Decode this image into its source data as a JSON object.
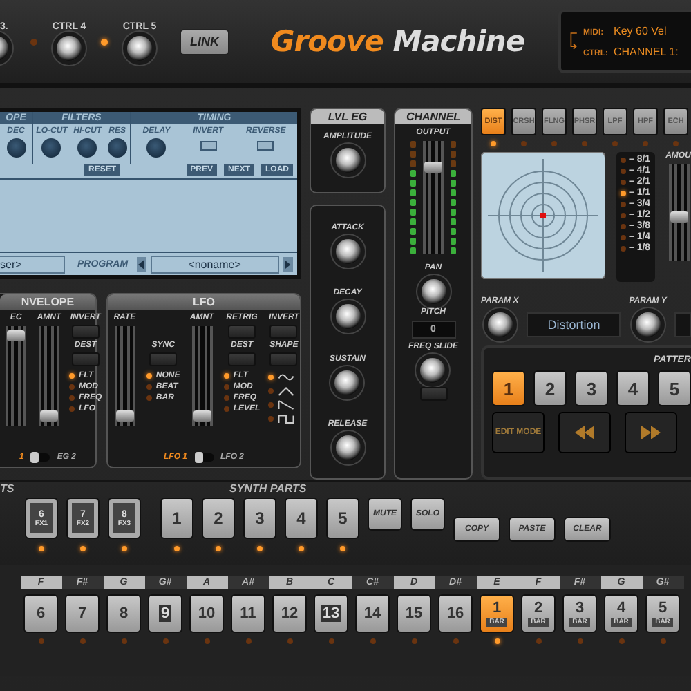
{
  "top": {
    "knobs": [
      {
        "label": "3."
      },
      {
        "label": "CTRL 4"
      },
      {
        "label": "CTRL 5"
      }
    ],
    "leds": [
      {
        "on": false
      },
      {
        "on": true
      }
    ],
    "link": "LINK",
    "logo": [
      "Groove",
      "Machine"
    ],
    "display": [
      {
        "label": "MIDI:",
        "value": "Key 60 Vel"
      },
      {
        "label": "CTRL:",
        "value": "CHANNEL 1:"
      }
    ]
  },
  "sample": {
    "sections": [
      {
        "title": "OPE",
        "knobs": [
          "DEC"
        ]
      },
      {
        "title": "FILTERS",
        "knobs": [
          "LO-CUT",
          "HI-CUT",
          "RES"
        ]
      },
      {
        "title": "TIMING",
        "knobs": [
          "DELAY"
        ],
        "toggles": [
          {
            "label": "INVERT",
            "on": false
          },
          {
            "label": "REVERSE",
            "on": false
          }
        ]
      }
    ],
    "buttons_left": [
      "RESET"
    ],
    "buttons_right": [
      "PREV",
      "NEXT",
      "LOAD"
    ],
    "sample_field": "ser>",
    "program_label": "PROGRAM",
    "program_value": "<noname>"
  },
  "lvl_eg": {
    "title": "LVL EG",
    "knob": "AMPLITUDE"
  },
  "amp_env": {
    "knobs": [
      "ATTACK",
      "DECAY",
      "SUSTAIN",
      "RELEASE"
    ]
  },
  "channel": {
    "title": "CHANNEL",
    "output_label": "OUTPUT",
    "level": 0.8,
    "pan": "PAN",
    "pitch_label": "PITCH",
    "pitch_value": "0",
    "freq_slide": "FREQ SLIDE"
  },
  "fx": {
    "tabs": [
      {
        "label": "DIST",
        "selected": true
      },
      {
        "label": "CRSH",
        "selected": false
      },
      {
        "label": "FLNG",
        "selected": false
      },
      {
        "label": "PHSR",
        "selected": false
      },
      {
        "label": "LPF",
        "selected": false
      },
      {
        "label": "HPF",
        "selected": false
      },
      {
        "label": "ECH",
        "selected": false
      }
    ],
    "rates": [
      {
        "label": "– 8/1",
        "selected": false
      },
      {
        "label": "– 4/1",
        "selected": false
      },
      {
        "label": "– 2/1",
        "selected": false
      },
      {
        "label": "– 1/1",
        "selected": true
      },
      {
        "label": "– 3/4",
        "selected": false
      },
      {
        "label": "– 1/2",
        "selected": false
      },
      {
        "label": "– 3/8",
        "selected": false
      },
      {
        "label": "– 1/4",
        "selected": false
      },
      {
        "label": "– 1/8",
        "selected": false
      }
    ],
    "amount": {
      "label": "AMOU",
      "level": 0.45
    },
    "param_x": "PARAM X",
    "effect_name": "Distortion",
    "param_y": "PARAM Y"
  },
  "envelope": {
    "title": "NVELOPE",
    "faders": [
      {
        "label": "EC",
        "level": 0.95
      },
      {
        "label": "AMNT",
        "level": 0.05
      }
    ],
    "invert": "INVERT",
    "dest": "DEST",
    "targets": [
      {
        "label": "FLT",
        "selected": true
      },
      {
        "label": "MOD",
        "selected": false
      },
      {
        "label": "FREQ",
        "selected": false
      },
      {
        "label": "LFO",
        "selected": false
      }
    ],
    "switch": [
      {
        "label": "1",
        "selected": true
      },
      {
        "label": "EG 2",
        "selected": false
      }
    ]
  },
  "lfo": {
    "title": "LFO",
    "rate": {
      "label": "RATE",
      "level": 0.05
    },
    "sync": "SYNC",
    "sync_options": [
      {
        "label": "NONE",
        "selected": true
      },
      {
        "label": "BEAT",
        "selected": false
      },
      {
        "label": "BAR",
        "selected": false
      }
    ],
    "amnt": {
      "label": "AMNT",
      "level": 0.05
    },
    "retrig": "RETRIG",
    "dest": "DEST",
    "dest_options": [
      {
        "label": "FLT",
        "selected": true
      },
      {
        "label": "MOD",
        "selected": false
      },
      {
        "label": "FREQ",
        "selected": false
      },
      {
        "label": "LEVEL",
        "selected": false
      }
    ],
    "invert": "INVERT",
    "shape": "SHAPE",
    "shapes": [
      {
        "kind": "sine",
        "selected": true
      },
      {
        "kind": "triangle",
        "selected": false
      },
      {
        "kind": "saw",
        "selected": false
      },
      {
        "kind": "square",
        "selected": false
      }
    ],
    "switch": [
      {
        "label": "LFO 1",
        "selected": true
      },
      {
        "label": "LFO 2",
        "selected": false
      }
    ]
  },
  "pattern": {
    "label": "PATTER",
    "buttons": [
      {
        "label": "1",
        "selected": true
      },
      {
        "label": "2",
        "selected": false
      },
      {
        "label": "3",
        "selected": false
      },
      {
        "label": "4",
        "selected": false
      },
      {
        "label": "5",
        "selected": false
      }
    ],
    "edit_mode": "EDIT MODE"
  },
  "parts": {
    "left_label": "TS",
    "fx_parts": [
      {
        "number": "6",
        "sub": "FX1"
      },
      {
        "number": "7",
        "sub": "FX2"
      },
      {
        "number": "8",
        "sub": "FX3"
      }
    ],
    "synth_label": "SYNTH PARTS",
    "synth_parts": [
      "1",
      "2",
      "3",
      "4",
      "5"
    ],
    "mute": "MUTE",
    "solo": "SOLO",
    "copy": "COPY",
    "paste": "PASTE",
    "clear": "CLEAR"
  },
  "steps": [
    {
      "note": "F",
      "sharp": false,
      "label": "6",
      "accent": false,
      "selected": false
    },
    {
      "note": "F#",
      "sharp": true,
      "label": "7",
      "accent": false,
      "selected": false
    },
    {
      "note": "G",
      "sharp": false,
      "label": "8",
      "accent": false,
      "selected": false
    },
    {
      "note": "G#",
      "sharp": true,
      "label": "9",
      "accent": true,
      "selected": false
    },
    {
      "note": "A",
      "sharp": false,
      "label": "10",
      "accent": false,
      "selected": false
    },
    {
      "note": "A#",
      "sharp": true,
      "label": "11",
      "accent": false,
      "selected": false
    },
    {
      "note": "B",
      "sharp": false,
      "label": "12",
      "accent": false,
      "selected": false
    },
    {
      "note": "C",
      "sharp": false,
      "label": "13",
      "accent": true,
      "selected": false
    },
    {
      "note": "C#",
      "sharp": true,
      "label": "14",
      "accent": false,
      "selected": false
    },
    {
      "note": "D",
      "sharp": false,
      "label": "15",
      "accent": false,
      "selected": false
    },
    {
      "note": "D#",
      "sharp": true,
      "label": "16",
      "accent": false,
      "selected": false
    },
    {
      "note": "E",
      "sharp": false,
      "label": "1",
      "sub": "BAR",
      "accent": false,
      "selected": true
    },
    {
      "note": "F",
      "sharp": false,
      "label": "2",
      "sub": "BAR",
      "accent": false,
      "selected": false
    },
    {
      "note": "F#",
      "sharp": true,
      "label": "3",
      "sub": "BAR",
      "accent": false,
      "selected": false
    },
    {
      "note": "G",
      "sharp": false,
      "label": "4",
      "sub": "BAR",
      "accent": false,
      "selected": false
    },
    {
      "note": "G#",
      "sharp": true,
      "label": "5",
      "sub": "BAR",
      "accent": false,
      "selected": false
    }
  ]
}
